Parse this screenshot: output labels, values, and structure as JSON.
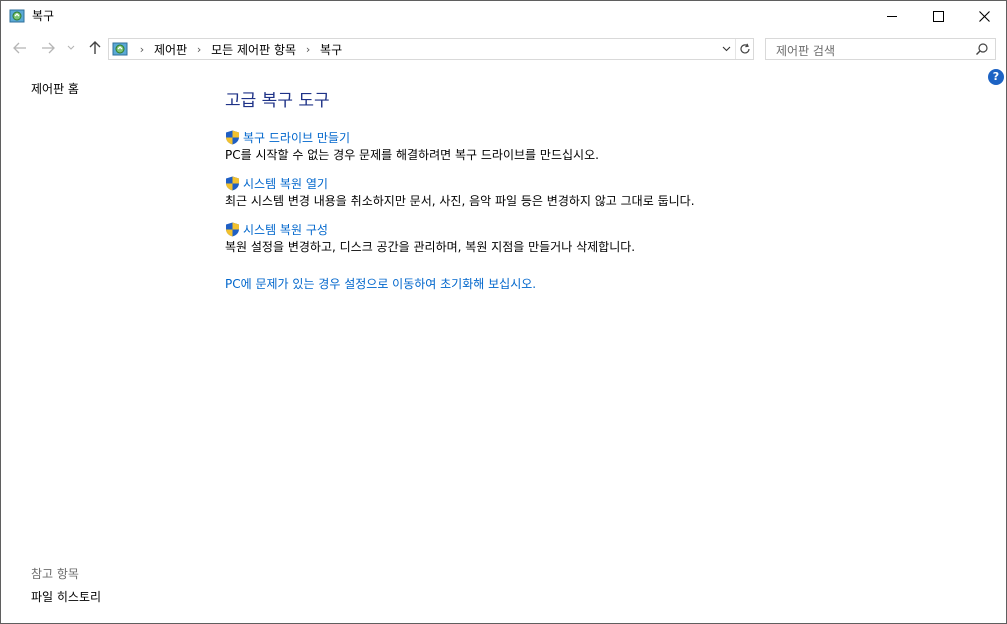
{
  "window": {
    "title": "복구"
  },
  "address_bar": {
    "breadcrumbs": [
      "제어판",
      "모든 제어판 항목",
      "복구"
    ]
  },
  "search": {
    "placeholder": "제어판 검색"
  },
  "left_pane": {
    "home_link": "제어판 홈",
    "see_also_title": "참고 항목",
    "see_also_links": [
      "파일 히스토리"
    ]
  },
  "main": {
    "title": "고급 복구 도구",
    "tasks": [
      {
        "link": "복구 드라이브 만들기",
        "description": "PC를 시작할 수 없는 경우 문제를 해결하려면 복구 드라이브를 만드십시오."
      },
      {
        "link": "시스템 복원 열기",
        "description": "최근 시스템 변경 내용을 취소하지만 문서, 사진, 음악 파일 등은 변경하지 않고 그대로 둡니다."
      },
      {
        "link": "시스템 복원 구성",
        "description": "복원 설정을 변경하고, 디스크 공간을 관리하며, 복원 지점을 만들거나 삭제합니다."
      }
    ],
    "bottom_link": "PC에 문제가 있는 경우 설정으로 이동하여 초기화해 보십시오."
  },
  "help": {
    "label": "?"
  },
  "colors": {
    "link": "#0066cc",
    "title": "#1e3287",
    "help": "#1d63c4"
  }
}
